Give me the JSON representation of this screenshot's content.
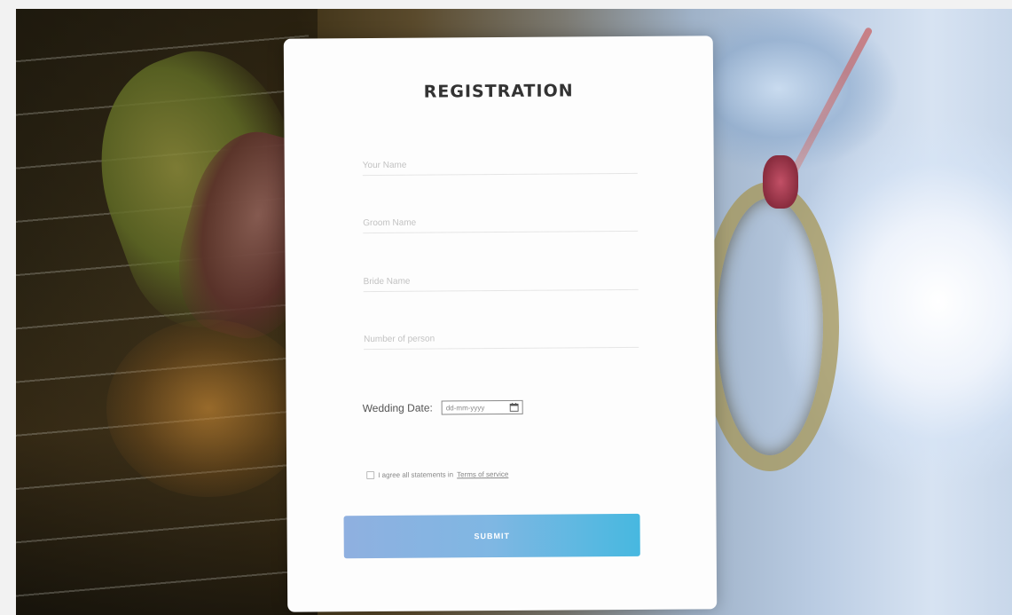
{
  "form": {
    "title": "REGISTRATION",
    "fields": [
      {
        "placeholder": "Your Name",
        "value": ""
      },
      {
        "placeholder": "Groom Name",
        "value": ""
      },
      {
        "placeholder": "Bride Name",
        "value": ""
      },
      {
        "placeholder": "Number of person",
        "value": ""
      }
    ],
    "wedding_date": {
      "label": "Wedding Date:",
      "value": "dd-mm-yyyy"
    },
    "agreement": {
      "text": "I agree all statements in",
      "link": "Terms of service"
    },
    "submit_label": "SUBMIT"
  },
  "colors": {
    "title": "#333333",
    "button_start": "#8fb0e0",
    "button_end": "#47b8e0",
    "card_background": "#fdfdfd"
  }
}
